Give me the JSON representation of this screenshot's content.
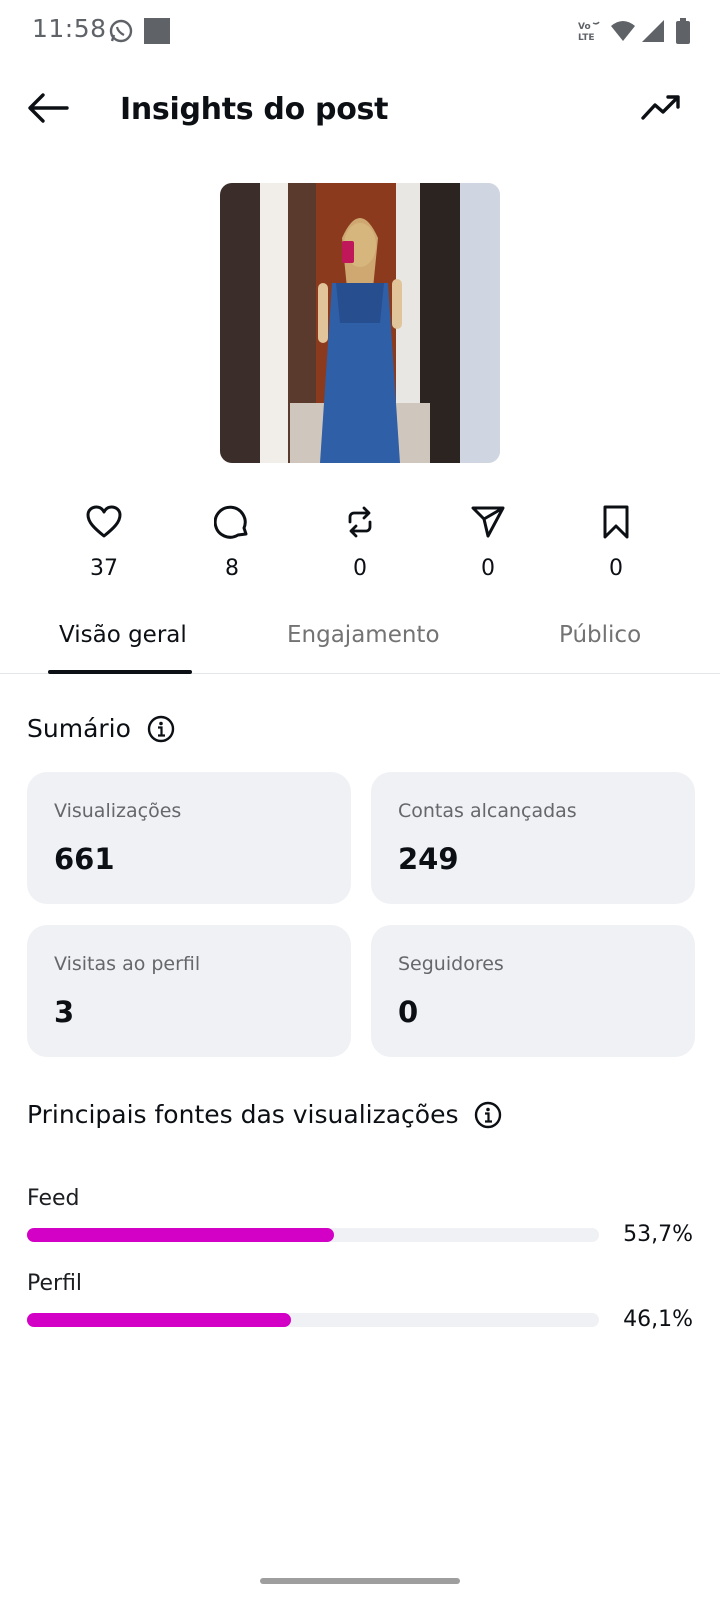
{
  "status_bar": {
    "time": "11:58",
    "left_icons": [
      "whatsapp-icon",
      "square-notification-icon"
    ],
    "right_icons": [
      "volte-icon",
      "wifi-icon",
      "signal-icon",
      "battery-icon"
    ],
    "volte_label": "Vo\nLTE"
  },
  "header": {
    "title": "Insights do post",
    "back_icon": "arrow-left-icon",
    "trend_icon": "trending-up-icon"
  },
  "post": {
    "image_description": "photo-thumbnail"
  },
  "metrics": [
    {
      "icon": "heart-icon",
      "value": "37"
    },
    {
      "icon": "comment-icon",
      "value": "8"
    },
    {
      "icon": "repost-icon",
      "value": "0"
    },
    {
      "icon": "share-icon",
      "value": "0"
    },
    {
      "icon": "bookmark-icon",
      "value": "0"
    }
  ],
  "tabs": [
    {
      "label": "Visão geral",
      "active": true
    },
    {
      "label": "Engajamento",
      "active": false
    },
    {
      "label": "Público",
      "active": false
    }
  ],
  "summary": {
    "title": "Sumário",
    "cards": [
      {
        "label": "Visualizações",
        "value": "661"
      },
      {
        "label": "Contas alcançadas",
        "value": "249"
      },
      {
        "label": "Visitas ao perfil",
        "value": "3"
      },
      {
        "label": "Seguidores",
        "value": "0"
      }
    ]
  },
  "sources": {
    "title": "Principais fontes das visualizações",
    "items": [
      {
        "label": "Feed",
        "percent_text": "53,7%",
        "fraction": 0.537
      },
      {
        "label": "Perfil",
        "percent_text": "46,1%",
        "fraction": 0.461
      }
    ]
  },
  "colors": {
    "accent_bar": "#d300c5",
    "card_bg": "#eff1f5",
    "text_primary": "#0c1014",
    "text_secondary": "#737373"
  }
}
